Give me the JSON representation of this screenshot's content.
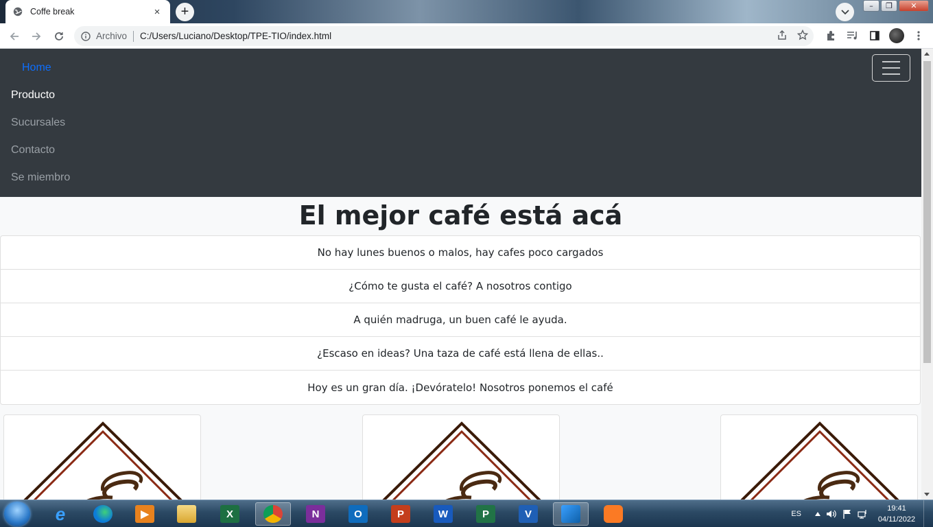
{
  "browser": {
    "tab_title": "Coffe break",
    "tab_close": "×",
    "new_tab": "+",
    "omnibox_label": "Archivo",
    "url": "C:/Users/Luciano/Desktop/TPE-TIO/index.html"
  },
  "window_controls": {
    "minimize": "–",
    "restore": "❐",
    "close": "✕"
  },
  "navbar": {
    "items": [
      {
        "label": "Home",
        "color": "#0d6efd"
      },
      {
        "label": "Producto",
        "color": "#ffffff"
      },
      {
        "label": "Sucursales",
        "color": "#9aa0a6"
      },
      {
        "label": "Contacto",
        "color": "#9aa0a6"
      },
      {
        "label": "Se miembro",
        "color": "#9aa0a6"
      }
    ]
  },
  "main": {
    "headline": "El mejor café está acá",
    "quotes": [
      "No hay lunes buenos o malos, hay cafes poco cargados",
      "¿Cómo te gusta el café? A nosotros contigo",
      "A quién madruga, un buen café le ayuda.",
      "¿Escaso en ideas? Una taza de café está llena de ellas..",
      "Hoy es un gran día. ¡Devóratelo! Nosotros ponemos el café"
    ]
  },
  "colors": {
    "navbar_bg": "#343a40",
    "logo_outer": "#3a1a08",
    "logo_inner": "#8b2a14",
    "cup": "#4a2a12"
  },
  "taskbar": {
    "apps": [
      {
        "icon": "internet-explorer-icon",
        "text": "e",
        "color": "#1e88e5"
      },
      {
        "icon": "edge-icon",
        "text": "",
        "color": "#0c7bd8"
      },
      {
        "icon": "media-player-icon",
        "text": "▶",
        "color": "#e8821e"
      },
      {
        "icon": "file-explorer-icon",
        "text": "",
        "color": "#e8c25a"
      },
      {
        "icon": "excel-icon",
        "text": "X",
        "color": "#1d6f42"
      },
      {
        "icon": "chrome-icon",
        "text": "",
        "color": "#db4437"
      },
      {
        "icon": "onenote-icon",
        "text": "N",
        "color": "#7b2e9b"
      },
      {
        "icon": "outlook-icon",
        "text": "O",
        "color": "#0f6cbd"
      },
      {
        "icon": "powerpoint-icon",
        "text": "P",
        "color": "#c43e1c"
      },
      {
        "icon": "word-icon",
        "text": "W",
        "color": "#185abd"
      },
      {
        "icon": "project-icon",
        "text": "P",
        "color": "#217346"
      },
      {
        "icon": "visio-icon",
        "text": "V",
        "color": "#1f5fb5"
      },
      {
        "icon": "vscode-icon",
        "text": "",
        "color": "#1e88e5"
      },
      {
        "icon": "xampp-icon",
        "text": "",
        "color": "#fb7a24"
      }
    ],
    "language": "ES",
    "time": "19:41",
    "date": "04/11/2022"
  }
}
